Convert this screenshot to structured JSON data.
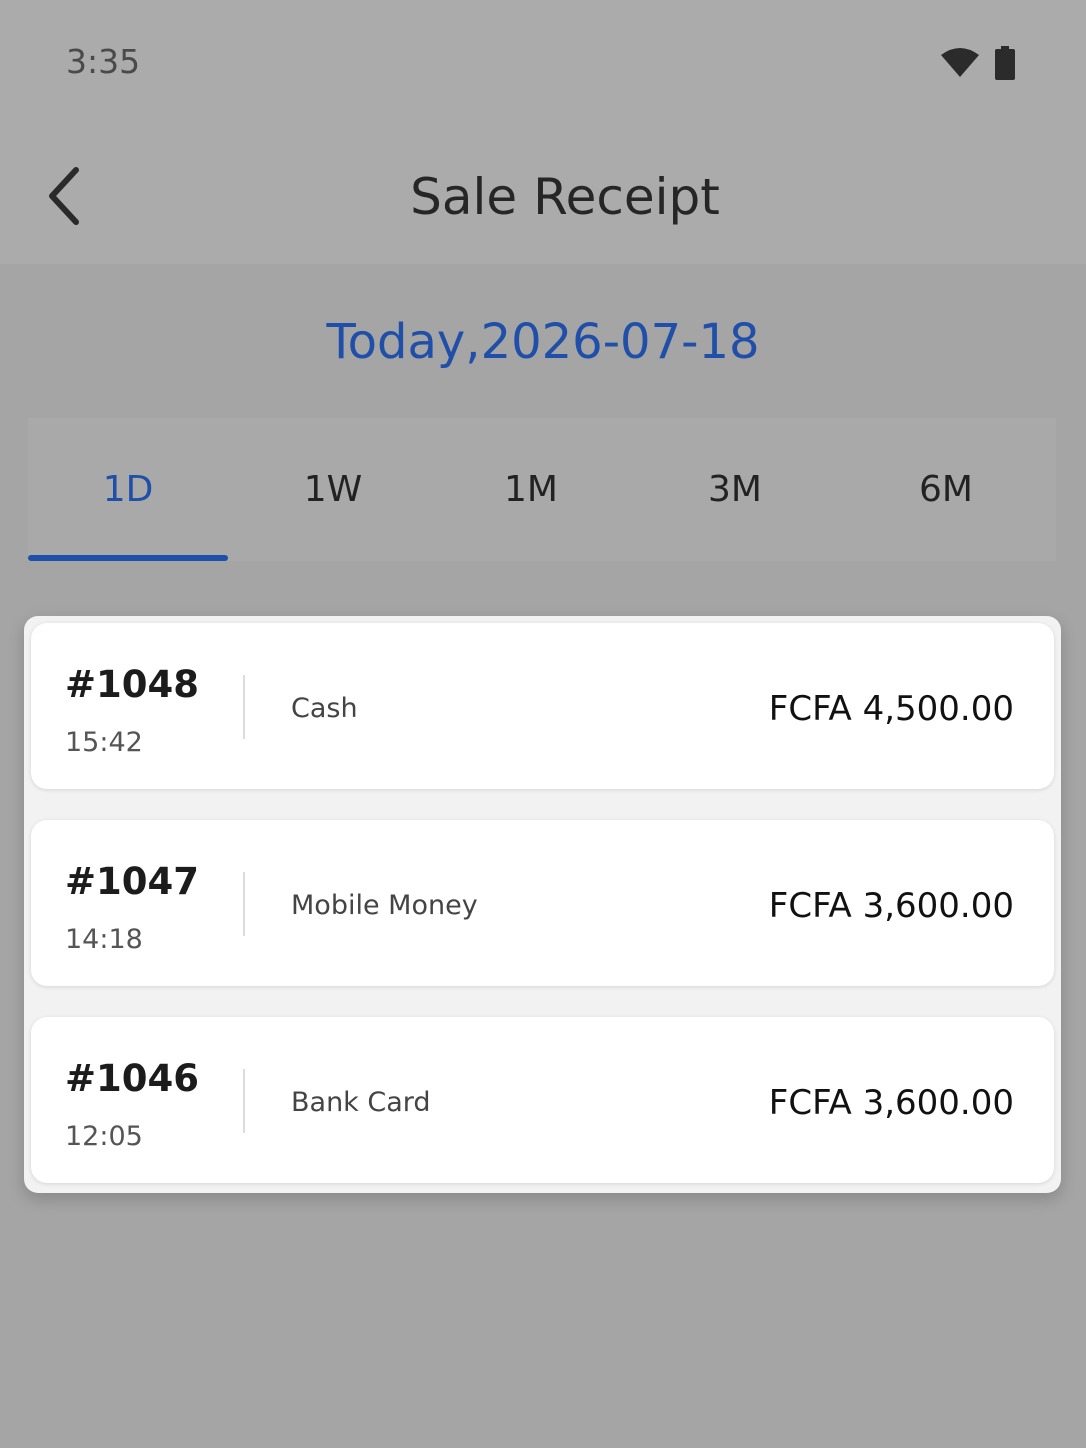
{
  "status_bar": {
    "time": "3:35",
    "icons": [
      "wifi-icon",
      "battery-icon"
    ]
  },
  "app_bar": {
    "title": "Sale Receipt",
    "back_icon": "chevron-left-icon"
  },
  "date_label": "Today,2026-07-18",
  "tabs": [
    {
      "label": "1D",
      "active": true
    },
    {
      "label": "1W",
      "active": false
    },
    {
      "label": "1M",
      "active": false
    },
    {
      "label": "3M",
      "active": false
    },
    {
      "label": "6M",
      "active": false
    }
  ],
  "receipts": [
    {
      "number": "#1048",
      "time": "15:42",
      "method": "Cash",
      "amount": "FCFA 4,500.00"
    },
    {
      "number": "#1047",
      "time": "14:18",
      "method": "Mobile Money",
      "amount": "FCFA 3,600.00"
    },
    {
      "number": "#1046",
      "time": "12:05",
      "method": "Bank Card",
      "amount": "FCFA 3,600.00"
    }
  ],
  "colors": {
    "accent": "#1f4fa8",
    "background": "#a5a5a5",
    "card": "#ffffff"
  }
}
